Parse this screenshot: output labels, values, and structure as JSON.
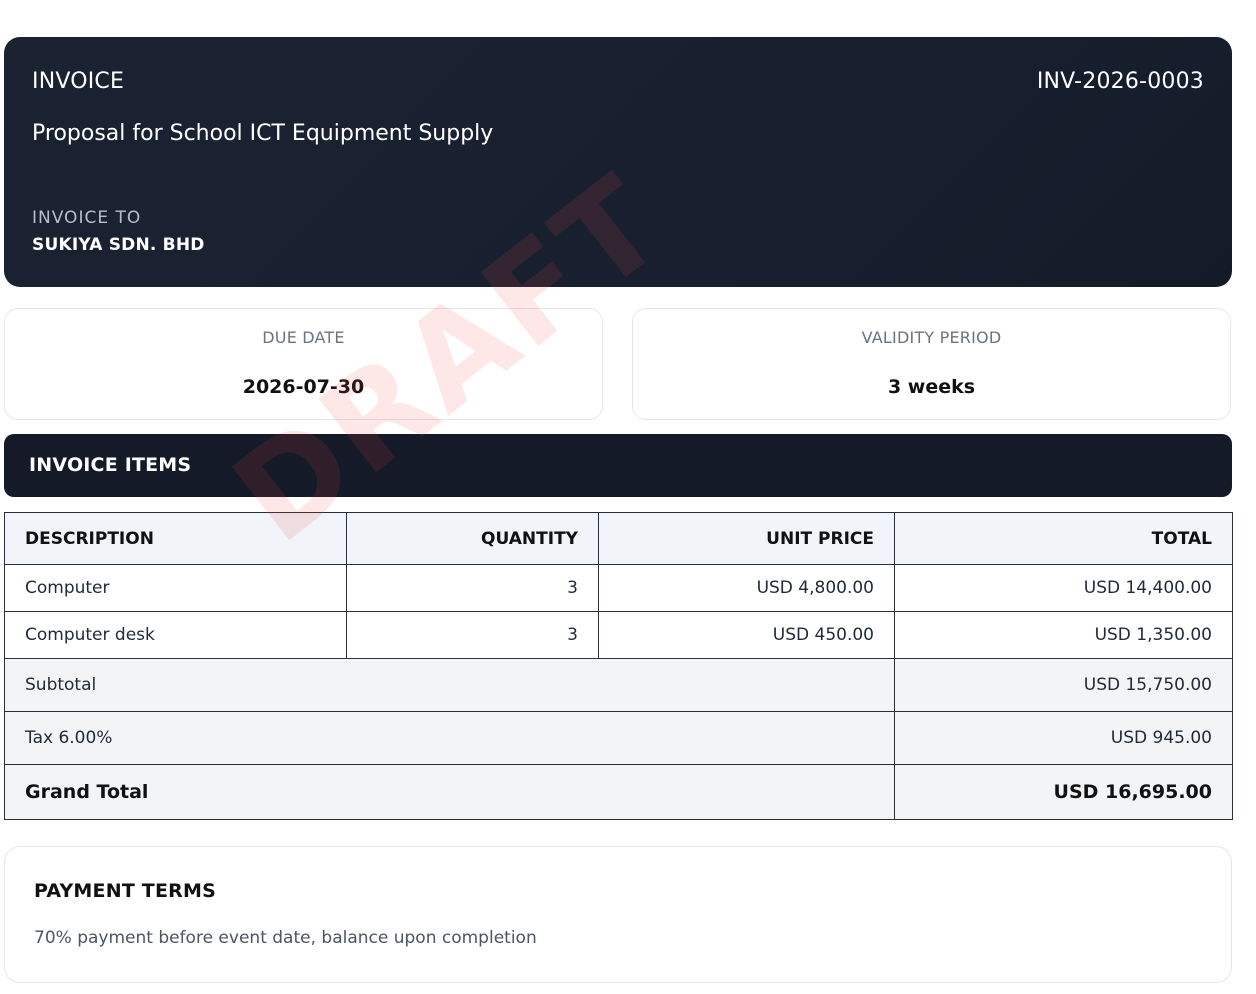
{
  "header": {
    "doc_type": "INVOICE",
    "doc_number": "INV-2026-0003",
    "subject": "Proposal for School ICT Equipment Supply",
    "to_label": "INVOICE TO",
    "to_name": "SUKIYA SDN. BHD"
  },
  "cards": {
    "due_date_label": "DUE DATE",
    "due_date_value": "2026-07-30",
    "validity_label": "VALIDITY PERIOD",
    "validity_value": "3 weeks"
  },
  "section_title": "INVOICE ITEMS",
  "table": {
    "columns": [
      "DESCRIPTION",
      "QUANTITY",
      "UNIT PRICE",
      "TOTAL"
    ],
    "rows": [
      [
        "Computer",
        "3",
        "USD 4,800.00",
        "USD 14,400.00"
      ],
      [
        "Computer desk",
        "3",
        "USD 450.00",
        "USD 1,350.00"
      ]
    ],
    "subtotal_label": "Subtotal",
    "subtotal_value": "USD 15,750.00",
    "tax_label": "Tax 6.00%",
    "tax_value": "USD 945.00",
    "grand_total_label": "Grand Total",
    "grand_total_value": "USD 16,695.00"
  },
  "terms": {
    "title": "PAYMENT TERMS",
    "text": "70% payment before event date, balance upon completion"
  },
  "watermark": "DRAFT",
  "colors": {
    "header_bg": "#1b2332",
    "section_bg": "#141a28",
    "watermark": "#ef4444"
  }
}
